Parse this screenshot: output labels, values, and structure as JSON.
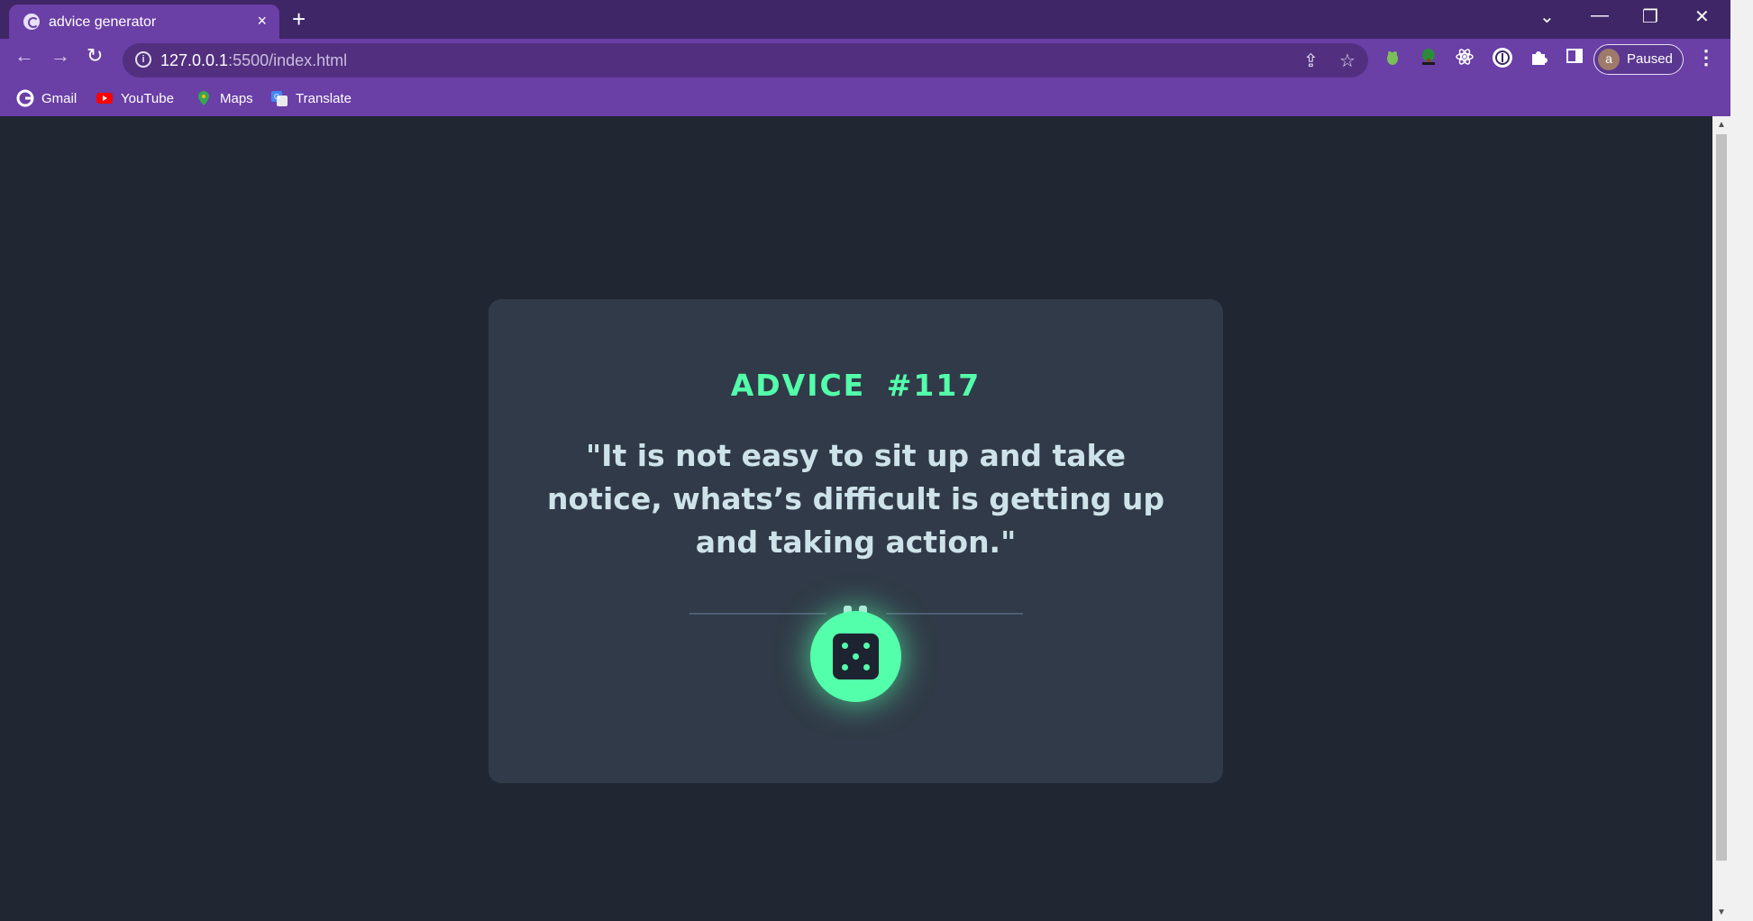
{
  "browser": {
    "tab_title": "advice generator",
    "tab_close_glyph": "×",
    "new_tab_glyph": "+",
    "tab_search_glyph": "⌄",
    "minimize_glyph": "—",
    "restore_glyph": "❐",
    "close_glyph": "✕",
    "back_glyph": "←",
    "forward_glyph": "→",
    "reload_glyph": "↻",
    "url_host": "127.0.0.1",
    "url_path": ":5500/index.html",
    "share_glyph": "⇪",
    "star_glyph": "☆",
    "profile_initial": "a",
    "profile_status": "Paused",
    "menu_glyph": "⋮",
    "extensions": [
      "frog-extension-icon",
      "tree-extension-icon",
      "react-devtools-icon",
      "circle-extension-icon",
      "puzzle-extensions-icon",
      "side-panel-icon"
    ]
  },
  "bookmarks": [
    {
      "label": "Gmail",
      "icon": "google-icon",
      "color": "#4285f4"
    },
    {
      "label": "YouTube",
      "icon": "youtube-icon",
      "color": "#ff0000"
    },
    {
      "label": "Maps",
      "icon": "maps-icon",
      "color": "#34a853"
    },
    {
      "label": "Translate",
      "icon": "translate-icon",
      "color": "#4285f4"
    }
  ],
  "scrollbar": {
    "up_glyph": "▲",
    "down_glyph": "▼"
  },
  "advice": {
    "id_label": "ADVICE #117",
    "text": "\"It is not easy to sit up and take notice, whats’s difficult is getting up and taking action.\""
  },
  "colors": {
    "accent_green": "#53ffaa",
    "card_bg": "#313a48",
    "page_bg": "#202632",
    "browser_purple": "#6a3fa6"
  }
}
